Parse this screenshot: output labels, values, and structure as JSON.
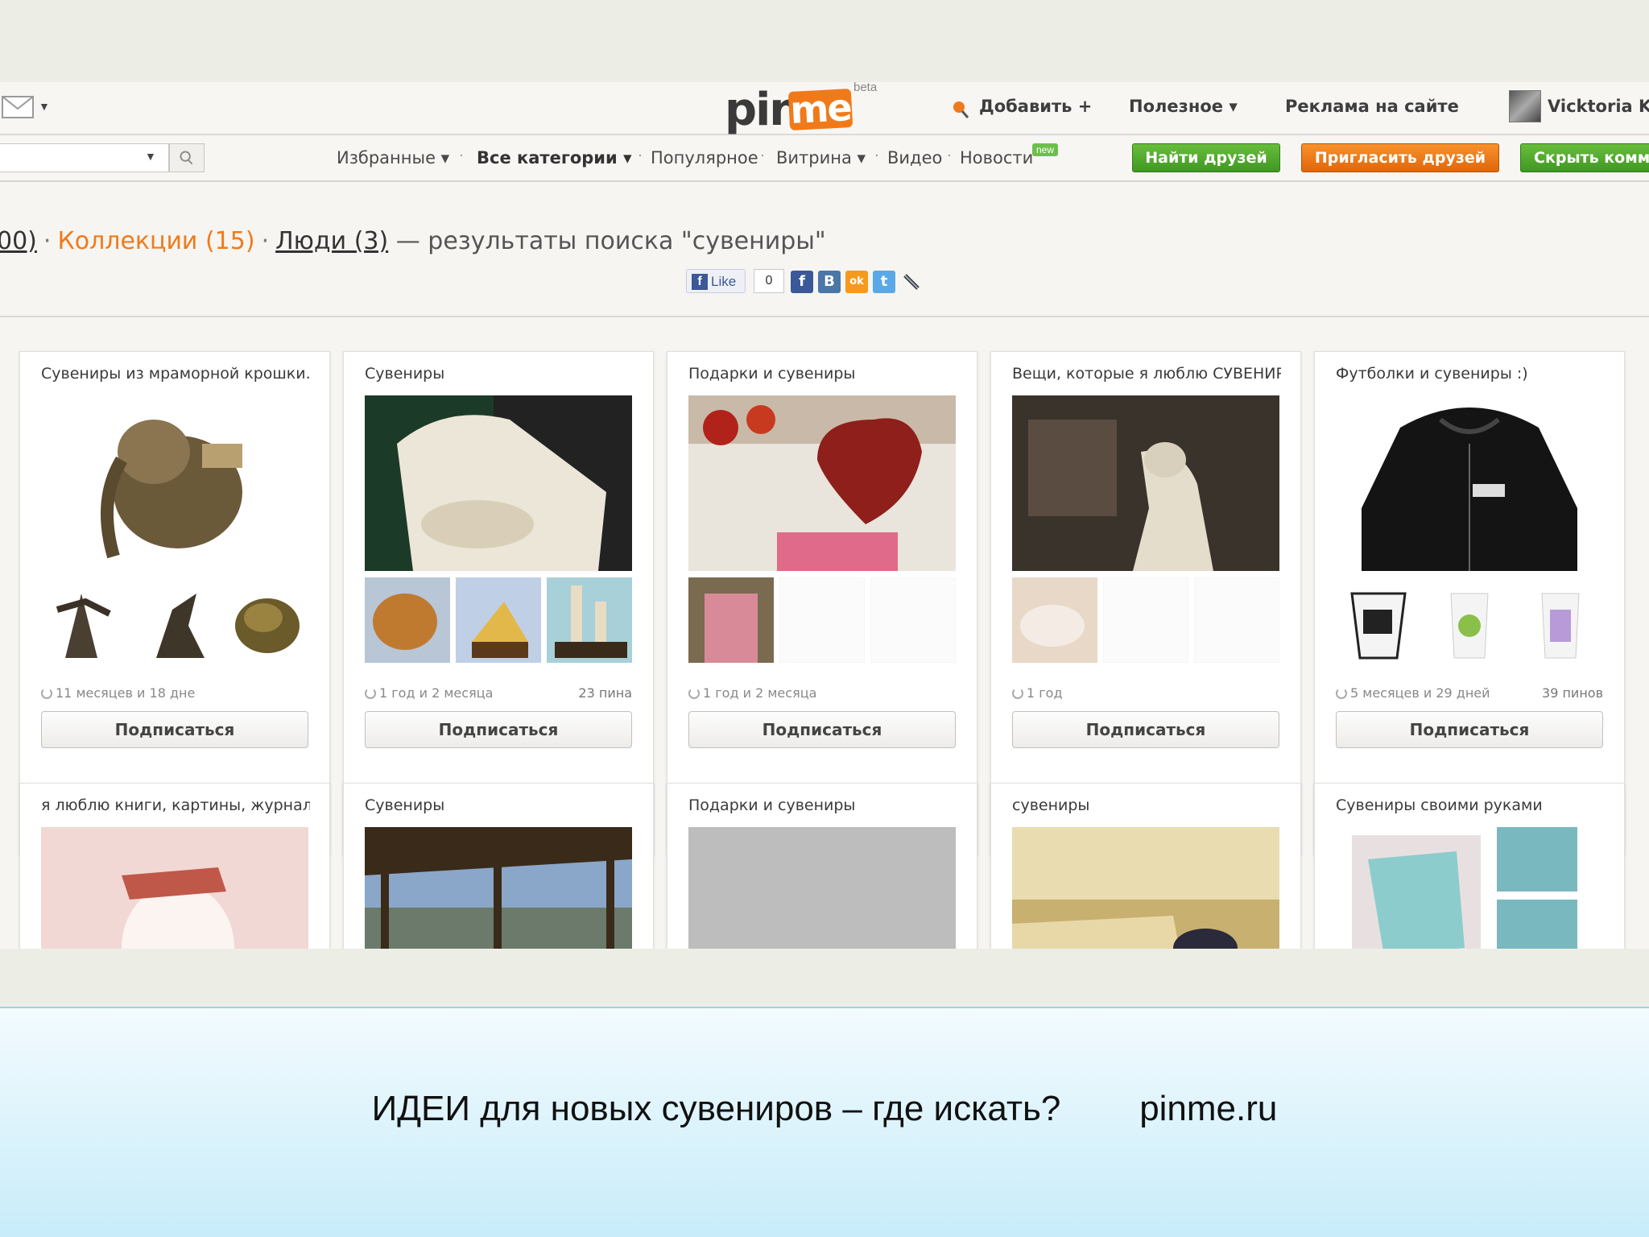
{
  "header": {
    "logo_pin": "pin",
    "logo_me": "me",
    "logo_beta": "beta",
    "add_label": "Добавить +",
    "useful_label": "Полезное ▾",
    "ads_label": "Реклама на сайте",
    "user_name": "Vicktoria Kc"
  },
  "subnav": {
    "favorites": "Избранные ▾",
    "all_categories": "Все категории ▾",
    "popular": "Популярное",
    "showcase": "Витрина ▾",
    "video": "Видео",
    "news": "Новости",
    "news_badge": "new",
    "find_friends": "Найти друзей",
    "invite_friends": "Пригласить друзей",
    "hide_comments": "Скрыть комментарии"
  },
  "breadcrumb": {
    "pins_tail": "00)",
    "collections": "Коллекции (15)",
    "people": "Люди (3)",
    "results_text": "— результаты поиска \"сувениры\""
  },
  "social": {
    "like_label": "Like",
    "like_count": "0",
    "fb": "f",
    "vk": "B",
    "ok": "ok",
    "tw": "t"
  },
  "cards": [
    {
      "title": "Сувениры из мраморной крошки.",
      "age": "11 месяцев и 18 дне",
      "count": "",
      "subscribe": "Подписаться"
    },
    {
      "title": "Сувениры",
      "age": "1 год и 2 месяца",
      "count": "23 пина",
      "subscribe": "Подписаться"
    },
    {
      "title": "Подарки и сувениры",
      "age": "1 год и 2 месяца",
      "count": "",
      "subscribe": "Подписаться"
    },
    {
      "title": "Вещи, которые я люблю СУВЕНИР",
      "age": "1 год",
      "count": "",
      "subscribe": "Подписаться"
    },
    {
      "title": "Футболки и сувениры :)",
      "age": "5 месяцев и 29 дней",
      "count": "39 пинов",
      "subscribe": "Подписаться"
    },
    {
      "title": "я люблю книги, картины, журнал"
    },
    {
      "title": "Сувениры"
    },
    {
      "title": "Подарки и сувениры"
    },
    {
      "title": "сувениры"
    },
    {
      "title": "Сувениры своими руками"
    }
  ],
  "banner": {
    "caption": "ИДЕИ для новых сувениров – где искать?        pinme.ru"
  },
  "colors": {
    "brand_orange": "#f07a1a",
    "button_green": "#4caa2b",
    "banner_blue": "#c8ecfa"
  }
}
